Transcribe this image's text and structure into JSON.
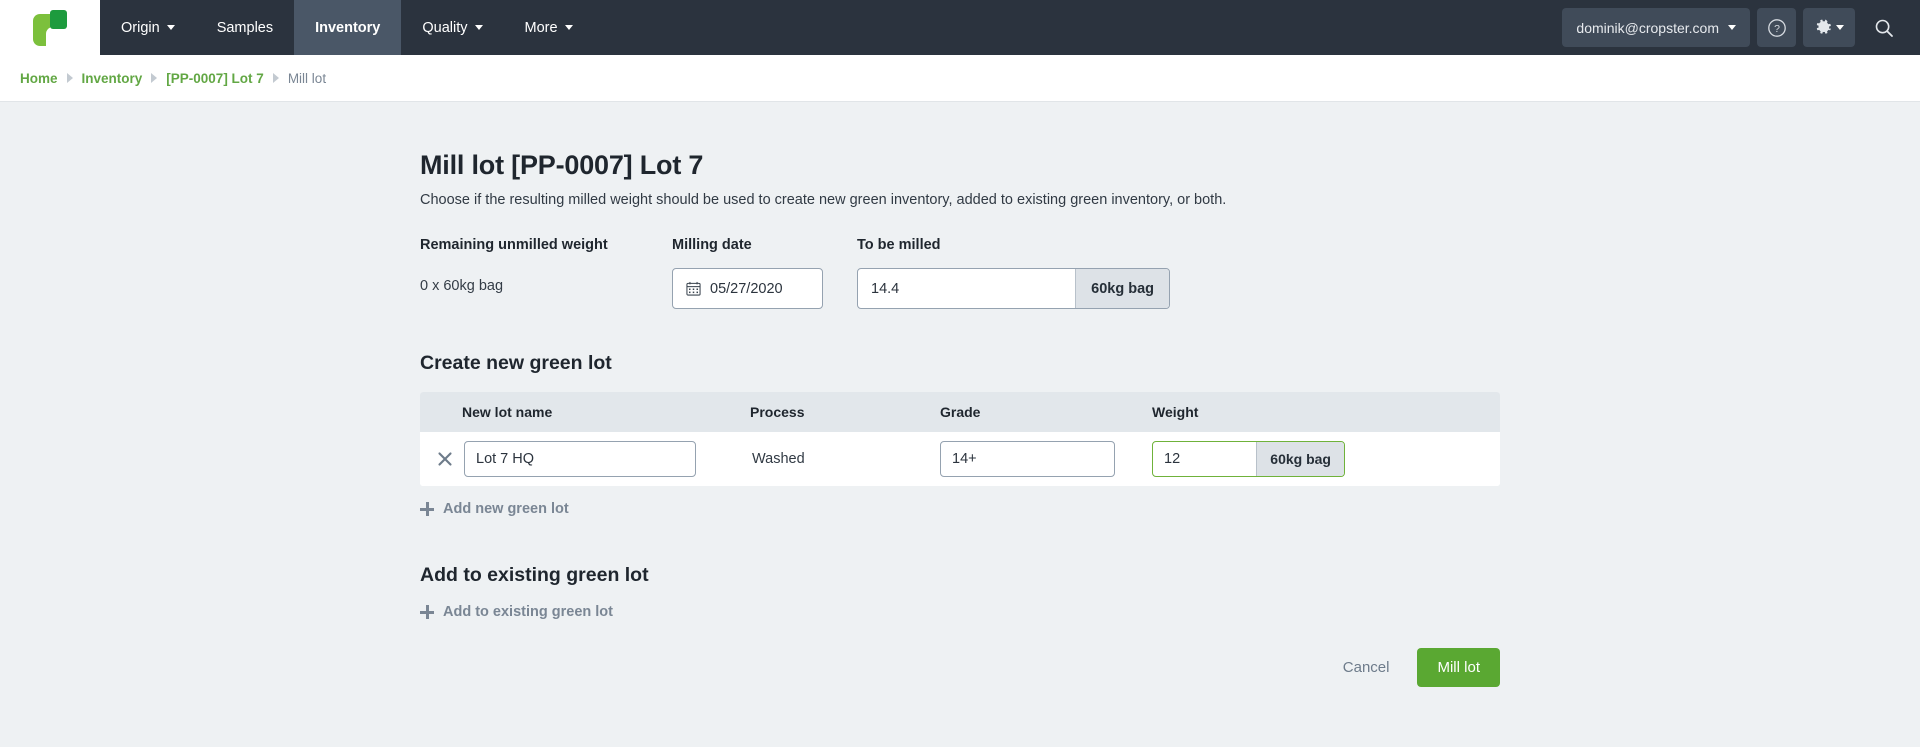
{
  "nav": {
    "logo_name": "cropster-logo",
    "items": [
      {
        "label": "Origin",
        "has_caret": true,
        "active": false
      },
      {
        "label": "Samples",
        "has_caret": false,
        "active": false
      },
      {
        "label": "Inventory",
        "has_caret": false,
        "active": true
      },
      {
        "label": "Quality",
        "has_caret": true,
        "active": false
      },
      {
        "label": "More",
        "has_caret": true,
        "active": false
      }
    ],
    "user_email": "dominik@cropster.com",
    "help_icon": "question-circle-icon",
    "settings_icon": "gear-icon",
    "search_icon": "search-icon"
  },
  "breadcrumb": {
    "items": [
      {
        "label": "Home",
        "current": false
      },
      {
        "label": "Inventory",
        "current": false
      },
      {
        "label": "[PP-0007] Lot 7",
        "current": false
      },
      {
        "label": "Mill lot",
        "current": true
      }
    ]
  },
  "main": {
    "title": "Mill lot [PP-0007] Lot 7",
    "description": "Choose if the resulting milled weight should be used to create new green inventory, added to existing green inventory, or both.",
    "fields": {
      "remaining_label": "Remaining unmilled weight",
      "remaining_value": "0 x 60kg bag",
      "milling_date_label": "Milling date",
      "milling_date_value": "05/27/2020",
      "calendar_icon": "calendar-icon",
      "to_be_milled_label": "To be milled",
      "to_be_milled_value": "14.4",
      "to_be_milled_unit": "60kg bag"
    },
    "create_section": {
      "title": "Create new green lot",
      "columns": {
        "name": "New lot name",
        "process": "Process",
        "grade": "Grade",
        "weight": "Weight"
      },
      "rows": [
        {
          "remove_icon": "close-icon",
          "name": "Lot 7 HQ",
          "process": "Washed",
          "grade": "14+",
          "weight": "12",
          "weight_unit": "60kg bag",
          "weight_focused": true
        }
      ],
      "add_link": "Add new green lot",
      "add_icon": "plus-icon"
    },
    "existing_section": {
      "title": "Add to existing green lot",
      "add_link": "Add to existing green lot",
      "add_icon": "plus-icon"
    },
    "actions": {
      "cancel": "Cancel",
      "submit": "Mill lot"
    }
  },
  "colors": {
    "nav_background": "#2b333e",
    "nav_active": "#4a5767",
    "page_background": "#eef1f3",
    "breadcrumb_link": "#62a744",
    "primary_button": "#5aa832",
    "input_focus_border": "#6fb23a",
    "logo_light_green": "#7cc03c",
    "logo_dark_green": "#1d9b3e",
    "table_header": "#e2e7eb"
  }
}
